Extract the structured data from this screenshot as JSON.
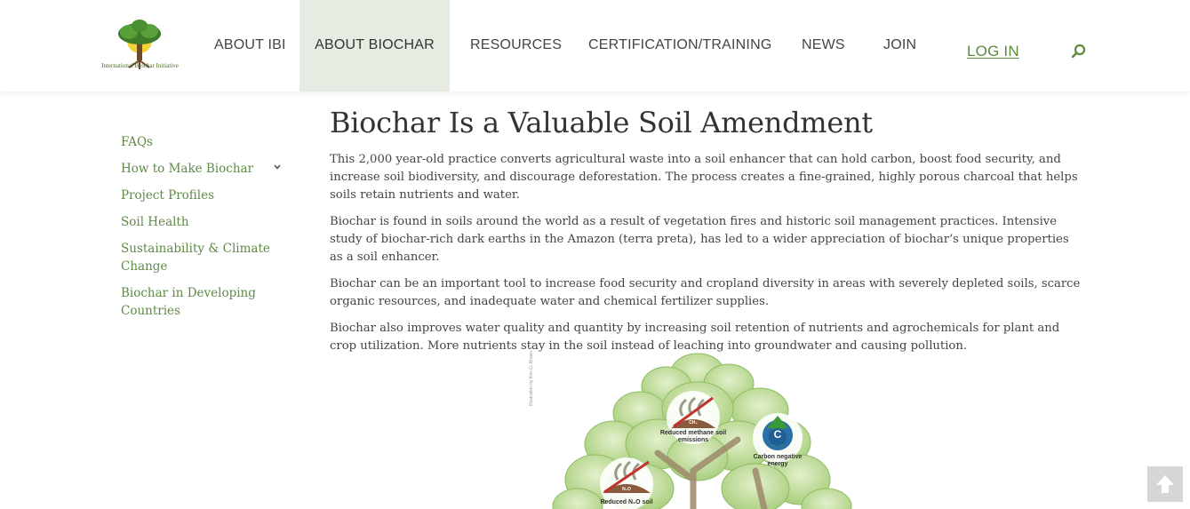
{
  "header": {
    "logo_text": "International Biochar Initiative",
    "nav": [
      {
        "label": "ABOUT IBI"
      },
      {
        "label": "ABOUT BIOCHAR"
      },
      {
        "label": "RESOURCES"
      },
      {
        "label": "CERTIFICATION/TRAINING"
      },
      {
        "label": "NEWS"
      },
      {
        "label": "JOIN"
      }
    ],
    "login_label": "LOG IN",
    "search_icon": "search-icon"
  },
  "sidebar": {
    "items": [
      {
        "label": "FAQs"
      },
      {
        "label": "How to Make Biochar"
      },
      {
        "label": "Project Profiles"
      },
      {
        "label": "Soil Health"
      },
      {
        "label": "Sustainability & Climate Change"
      },
      {
        "label": "Biochar in Developing Countries"
      }
    ]
  },
  "main": {
    "title": "Biochar Is a Valuable Soil Amendment",
    "paragraphs": [
      "This 2,000 year-old practice converts agricultural waste into a soil enhancer that can hold carbon, boost food security, and increase soil biodiversity, and discourage deforestation. The process creates a fine-grained, highly porous charcoal that helps soils retain nutrients and water.",
      "Biochar is found in soils around the world as a result of vegetation fires and historic soil management practices. Intensive study of biochar-rich dark earths in the Amazon (terra preta), has led to a wider appreciation of biochar’s unique properties as a soil enhancer.",
      "Biochar can be an important tool to increase food security and cropland diversity in areas with severely depleted soils, scarce organic resources, and inadequate water and chemical fertilizer supplies.",
      "Biochar also improves water quality and quantity by increasing soil retention of nutrients and agrochemicals for plant and crop utilization. More nutrients stay in the soil instead of leaching into groundwater and causing pollution."
    ]
  },
  "figure": {
    "caption": "Illustration by Ken G. Brown",
    "labels": {
      "methane": "Reduced methane soil emissions",
      "methane_gas": "CH₄",
      "carbon": "Carbon negative energy",
      "carbon_letter": "C",
      "n2o": "Reduced N₂O soil",
      "n2o_gas": "N₂O"
    }
  },
  "colors": {
    "link_green": "#5e8a45",
    "active_nav_bg": "#e7ece2"
  }
}
